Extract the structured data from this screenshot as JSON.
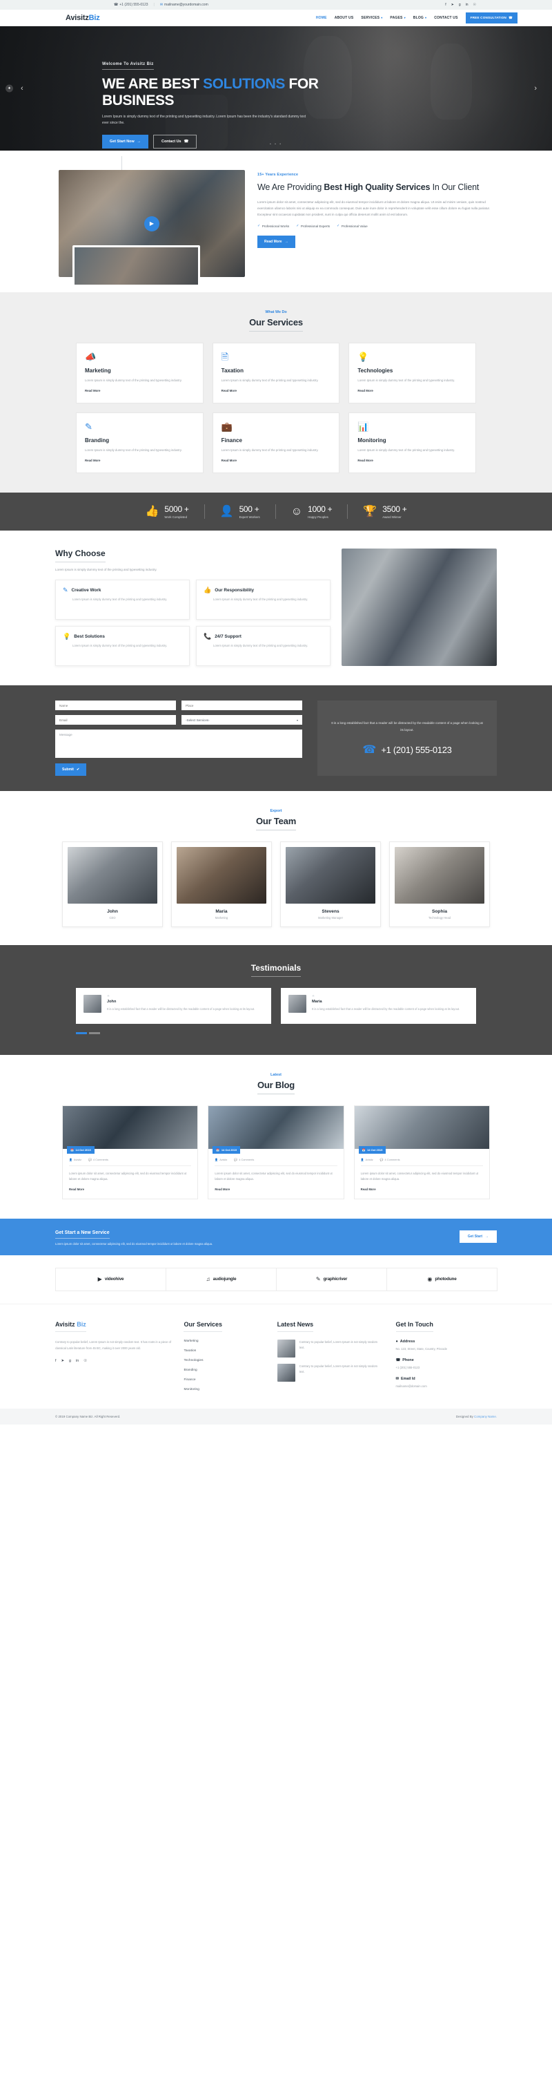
{
  "topbar": {
    "phone": "+1 (201) 555-0123",
    "phone_icon": "phone-icon",
    "email": "mailname@yourdomain.com",
    "email_icon": "envelope-icon",
    "socials": [
      "f",
      "⬤",
      "g",
      "in",
      "∘"
    ],
    "social_names": [
      "facebook-icon",
      "twitter-icon",
      "google-plus-icon",
      "linkedin-icon",
      "pinterest-icon"
    ]
  },
  "nav": {
    "logo_main": "Avisitz",
    "logo_accent": "Biz",
    "items": [
      {
        "label": "HOME",
        "caret": "",
        "active": true
      },
      {
        "label": "ABOUT US",
        "caret": "",
        "active": false
      },
      {
        "label": "SERVICES",
        "caret": "▾",
        "active": false
      },
      {
        "label": "PAGES",
        "caret": "▾",
        "active": false
      },
      {
        "label": "BLOG",
        "caret": "▾",
        "active": false
      },
      {
        "label": "CONTACT US",
        "caret": "",
        "active": false
      }
    ],
    "cta_label": "FREE CONSULTATION",
    "cta_icon": "☎"
  },
  "hero": {
    "welcome": "Welcome To Avisitz Biz",
    "title_a": "WE ARE BEST ",
    "title_hl": "SOLUTIONS",
    "title_b": " FOR BUSINESS",
    "paragraph": "Lorem Ipsum is simply dummy text of the printing and typesetting industry. Lorem Ipsum has been the industry's standard dummy text ever since the.",
    "btn_primary": "Get Start Now",
    "btn_primary_icon": "→",
    "btn_secondary": "Contact Us",
    "btn_secondary_icon": "☎",
    "prev_icon": "‹",
    "next_icon": "›",
    "dots": "• • •"
  },
  "about": {
    "eyebrow": "15+ Years Experience",
    "title_a": "We Are Providing ",
    "title_b": "Best High Quality Services",
    "title_c": " In Our Client",
    "paragraph": "Lorem ipsum dolor sit amet, consectetur adipiscing elit, sed do eiusmod tempor incididunt ut labore et dolore magna aliqua. Ut enim ad minim veniam, quis nostrud exercitation ullamco laboris nisi ut aliquip ex ea commodo consequat. Duis aute irure dolor in reprehenderit in voluptate velit esse cillum dolore eu fugiat nulla pariatur. Excepteur sint occaecat cupidatat non proident, sunt in culpa qui officia deserunt mollit anim id est laborum.",
    "features": [
      "Professional Works",
      "Professional Experts",
      "Professional Value"
    ],
    "btn": "Read More",
    "btn_icon": "→",
    "play_icon": "▶"
  },
  "services": {
    "eyebrow": "What We Do",
    "title": "Our Services",
    "read_more": "Read More",
    "body": "Lorem Ipsum is simply dummy text of the printing and typesetting industry.",
    "cards": [
      {
        "icon": "📣",
        "icon_name": "megaphone-icon",
        "title": "Marketing"
      },
      {
        "icon": "🗎",
        "icon_name": "document-icon",
        "title": "Taxation"
      },
      {
        "icon": "💡",
        "icon_name": "lightbulb-icon",
        "title": "Technologies"
      },
      {
        "icon": "✎",
        "icon_name": "pencil-icon",
        "title": "Branding"
      },
      {
        "icon": "💼",
        "icon_name": "briefcase-icon",
        "title": "Finance"
      },
      {
        "icon": "📊",
        "icon_name": "bar-chart-icon",
        "title": "Monitoring"
      }
    ]
  },
  "counters": [
    {
      "icon": "👍",
      "icon_name": "thumbs-up-icon",
      "value": "5000 +",
      "label": "Work Completed"
    },
    {
      "icon": "👤",
      "icon_name": "user-icon",
      "value": "500 +",
      "label": "Expert Workers"
    },
    {
      "icon": "☺",
      "icon_name": "smiley-icon",
      "value": "1000 +",
      "label": "Happy Peoples"
    },
    {
      "icon": "🏆",
      "icon_name": "trophy-icon",
      "value": "3500 +",
      "label": "Award Winner"
    }
  ],
  "why": {
    "title": "Why Choose",
    "subtitle": "Lorem Ipsum is simply dummy text of the printing and typesetting industry.",
    "body": "Lorem Ipsum is simply dummy text of the printing and typesetting industry.",
    "cards": [
      {
        "icon": "✎",
        "icon_name": "pencil-icon",
        "title": "Creative Work"
      },
      {
        "icon": "👍",
        "icon_name": "thumbs-up-icon",
        "title": "Our Responsibility"
      },
      {
        "icon": "💡",
        "icon_name": "lightbulb-icon",
        "title": "Best Solutions"
      },
      {
        "icon": "📞",
        "icon_name": "phone-icon",
        "title": "24/7 Support"
      }
    ]
  },
  "contact": {
    "name_placeholder": "Name",
    "place_placeholder": "Place",
    "email_placeholder": "Email",
    "select_value": "-Select Services-",
    "message_placeholder": "Message",
    "submit_label": "Submit",
    "submit_icon": "✔",
    "info_text": "It is a long established fact that a reader will be distracted by the readable content of a page when looking at its layout.",
    "phone": "+1 (201) 555-0123",
    "phone_icon": "phone-icon"
  },
  "team": {
    "eyebrow": "Export",
    "title": "Our Team",
    "members": [
      {
        "name": "John",
        "role": "CEO"
      },
      {
        "name": "Maria",
        "role": "Marketing"
      },
      {
        "name": "Stevens",
        "role": "Marketing Manager"
      },
      {
        "name": "Sophia",
        "role": "Technology Head"
      }
    ]
  },
  "testimonials": {
    "title": "Testimonials",
    "quote_icon": "❝",
    "items": [
      {
        "name": "John",
        "text": "It is a long established fact that a reader will be distracted by the readable content of a page when looking at its layout."
      },
      {
        "name": "Maria",
        "text": "It is a long established fact that a reader will be distracted by the readable content of a page when looking at its layout."
      }
    ]
  },
  "blog": {
    "eyebrow": "Latest",
    "title": "Our Blog",
    "read_more": "Read More",
    "posts": [
      {
        "date": "14 Oct 2019",
        "author": "Avisitz",
        "comments": "4 Comments",
        "text": "Lorem ipsum dolor sit amet, consectetur adipiscing elit, sed do eiusmod tempor incididunt ut labore et dolore magna aliqua."
      },
      {
        "date": "14 Oct 2019",
        "author": "Avisitz",
        "comments": "4 Comments",
        "text": "Lorem ipsum dolor sit amet, consectetur adipiscing elit, sed do eiusmod tempor incididunt ut labore et dolore magna aliqua."
      },
      {
        "date": "14 Oct 2019",
        "author": "Avisitz",
        "comments": "4 Comments",
        "text": "Lorem ipsum dolor sit amet, consectetur adipiscing elit, sed do eiusmod tempor incididunt ut labore et dolore magna aliqua."
      }
    ],
    "date_icon": "📅",
    "user_icon": "👤",
    "comment_icon": "💬"
  },
  "cta": {
    "title": "Get Start a New Service",
    "paragraph": "Lorem ipsum dolor sit amet, consectetur adipiscing elit, sed do eiusmod tempor incididunt ut labore et dolore magna aliqua.",
    "btn": "Get Start",
    "btn_icon": "→"
  },
  "brands": [
    {
      "icon": "▶",
      "icon_name": "videohive-icon",
      "name": "videohive"
    },
    {
      "icon": "♪",
      "icon_name": "audiojungle-icon",
      "name": "audiojungle"
    },
    {
      "icon": "✎",
      "icon_name": "graphicriver-icon",
      "name": "graphicriver"
    },
    {
      "icon": "◉",
      "icon_name": "photodune-icon",
      "name": "photodune"
    }
  ],
  "footer": {
    "about": {
      "logo_main": "Avisitz",
      "logo_accent": "Biz",
      "text": "Contrary to popular belief, Lorem Ipsum is not simply random text. It has roots in a piece of classical Latin literature from 45 BC, making it over 2000 years old.",
      "socials": [
        "f",
        "⬤",
        "g",
        "in",
        "∘"
      ],
      "social_names": [
        "facebook-icon",
        "twitter-icon",
        "google-plus-icon",
        "linkedin-icon",
        "pinterest-icon"
      ]
    },
    "services": {
      "title": "Our Services",
      "items": [
        "Marketing",
        "Taxation",
        "Technologies",
        "Branding",
        "Finance",
        "Monitoring"
      ]
    },
    "news": {
      "title": "Latest News",
      "items": [
        {
          "text": "Contrary to popular belief, Lorem Ipsum is not simply random text."
        },
        {
          "text": "Contrary to popular belief, Lorem Ipsum is not simply random text."
        }
      ]
    },
    "touch": {
      "title": "Get In Touch",
      "address_label": "Address",
      "address_icon": "📍",
      "address_value": "No. 123, Street, State, Country, Pincode",
      "phone_label": "Phone",
      "phone_icon": "☎",
      "phone_value": "+1 (201) 555-0123",
      "email_label": "Email Id",
      "email_icon": "✉",
      "email_value": "mailname@domain.com"
    },
    "copyright": "© 2019 Company Name Biz. All Right Reseverd.",
    "designed_pre": "Designed By ",
    "designed_link": "Company Name."
  }
}
